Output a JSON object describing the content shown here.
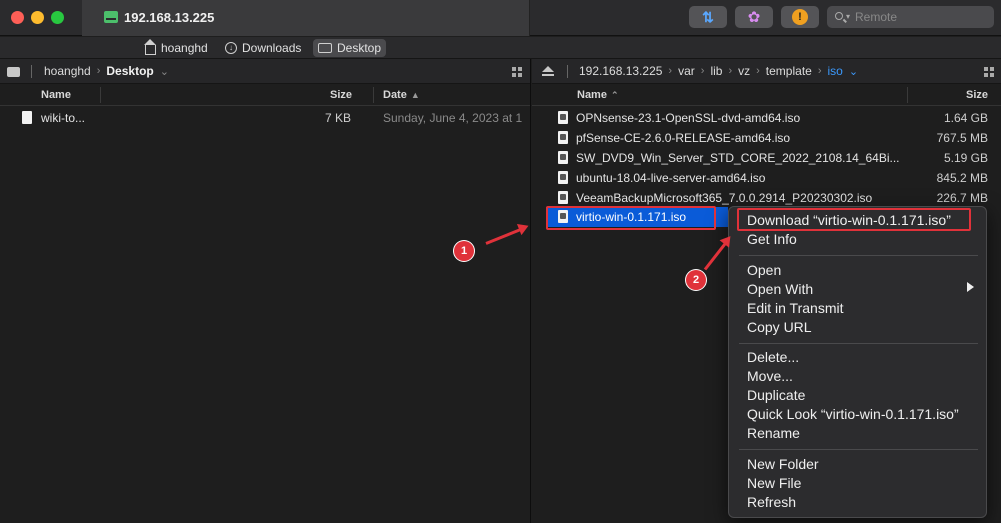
{
  "window": {
    "tab_title": "192.168.13.225",
    "search_placeholder": "Remote"
  },
  "icons": {
    "sync": "⇅",
    "transmit_flower": "✿",
    "info": "!"
  },
  "favorites": [
    {
      "label": "hoanghd",
      "icon": "home-icon"
    },
    {
      "label": "Downloads",
      "icon": "download-icon"
    },
    {
      "label": "Desktop",
      "icon": "desktop-icon",
      "active": true
    }
  ],
  "left_pane": {
    "crumbs": [
      "hoanghd",
      "Desktop"
    ],
    "columns": {
      "name": "Name",
      "size": "Size",
      "date": "Date"
    },
    "files": [
      {
        "name": "wiki-to...",
        "size": "7 KB",
        "date": "Sunday, June 4, 2023 at 1"
      }
    ]
  },
  "right_pane": {
    "crumbs": [
      "192.168.13.225",
      "var",
      "lib",
      "vz",
      "template",
      "iso"
    ],
    "columns": {
      "name": "Name",
      "size": "Size"
    },
    "files": [
      {
        "name": "OPNsense-23.1-OpenSSL-dvd-amd64.iso",
        "size": "1.64 GB"
      },
      {
        "name": "pfSense-CE-2.6.0-RELEASE-amd64.iso",
        "size": "767.5 MB"
      },
      {
        "name": "SW_DVD9_Win_Server_STD_CORE_2022_2108.14_64Bi...",
        "size": "5.19 GB"
      },
      {
        "name": "ubuntu-18.04-live-server-amd64.iso",
        "size": "845.2 MB"
      },
      {
        "name": "VeeamBackupMicrosoft365_7.0.0.2914_P20230302.iso",
        "size": "226.7 MB"
      },
      {
        "name": "virtio-win-0.1.171.iso",
        "size": "",
        "selected": true
      }
    ]
  },
  "context_menu": {
    "groups": [
      [
        "Download “virtio-win-0.1.171.iso”",
        "Get Info"
      ],
      [
        "Open",
        "Open With",
        "Edit in Transmit",
        "Copy URL"
      ],
      [
        "Delete...",
        "Move...",
        "Duplicate",
        "Quick Look “virtio-win-0.1.171.iso”",
        "Rename"
      ],
      [
        "New Folder",
        "New File",
        "Refresh"
      ]
    ]
  },
  "annotations": {
    "step1": "1",
    "step2": "2",
    "color": "#e0323a"
  },
  "colors": {
    "selection": "#0a5bd8",
    "accent_blue": "#3b99fc"
  }
}
